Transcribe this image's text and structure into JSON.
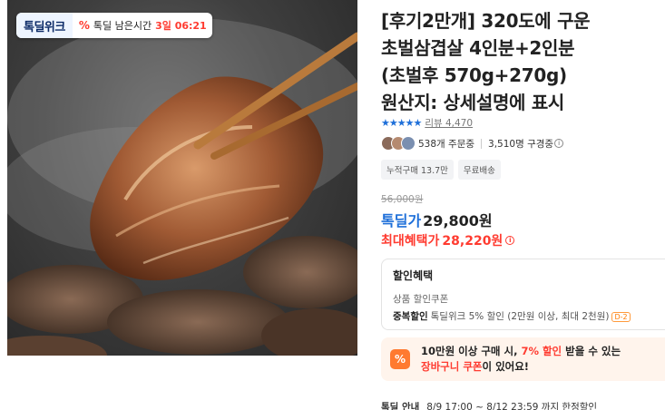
{
  "promo_banner": {
    "logo": "톡딜위크",
    "icon": "percent-icon",
    "countdown_label": "톡딜 남은시간",
    "countdown_value": "3일 06:21"
  },
  "product": {
    "title_lines": [
      "[후기2만개] 320도에 구운",
      "초벌삼겹살 4인분+2인분",
      "(초벌후 570g+270g)",
      "원산지: 상세설명에 표시"
    ],
    "rating_stars": 4.5,
    "rating_star_color": "#1e6fd9",
    "review_link": "리뷰 4,470",
    "ordering_count": "538개 주문중",
    "viewing_count": "3,510명 구경중",
    "chips": [
      "누적구매 13.7만",
      "무료배송"
    ]
  },
  "pricing": {
    "original_price": "56,000원",
    "deal_label": "톡딜가",
    "deal_price": "29,800원",
    "max_benefit_label": "최대혜택가",
    "max_benefit_price": "28,220원"
  },
  "benefit_box": {
    "title": "할인혜택",
    "product_coupon": "상품 할인쿠폰",
    "stack_label": "중복할인",
    "stack_text": "톡딜위크 5% 할인 (2만원 이상, 최대 2천원)",
    "d_day": "D-2"
  },
  "coupon_banner": {
    "icon": "percent-icon",
    "line1_a": "10만원 이상 구매 시, ",
    "line1_highlight": "7% 할인",
    "line1_b": " 받을 수 있는",
    "line2_highlight": "장바구니 쿠폰",
    "line2_b": "이 있어요!"
  },
  "notice": {
    "label": "톡딜 안내",
    "text": "8/9 17:00 ~ 8/12 23:59 까지 한정할인"
  },
  "colors": {
    "accent_blue": "#1e6fd9",
    "accent_red": "#ff3b30",
    "coupon_orange": "#ff7a30"
  }
}
